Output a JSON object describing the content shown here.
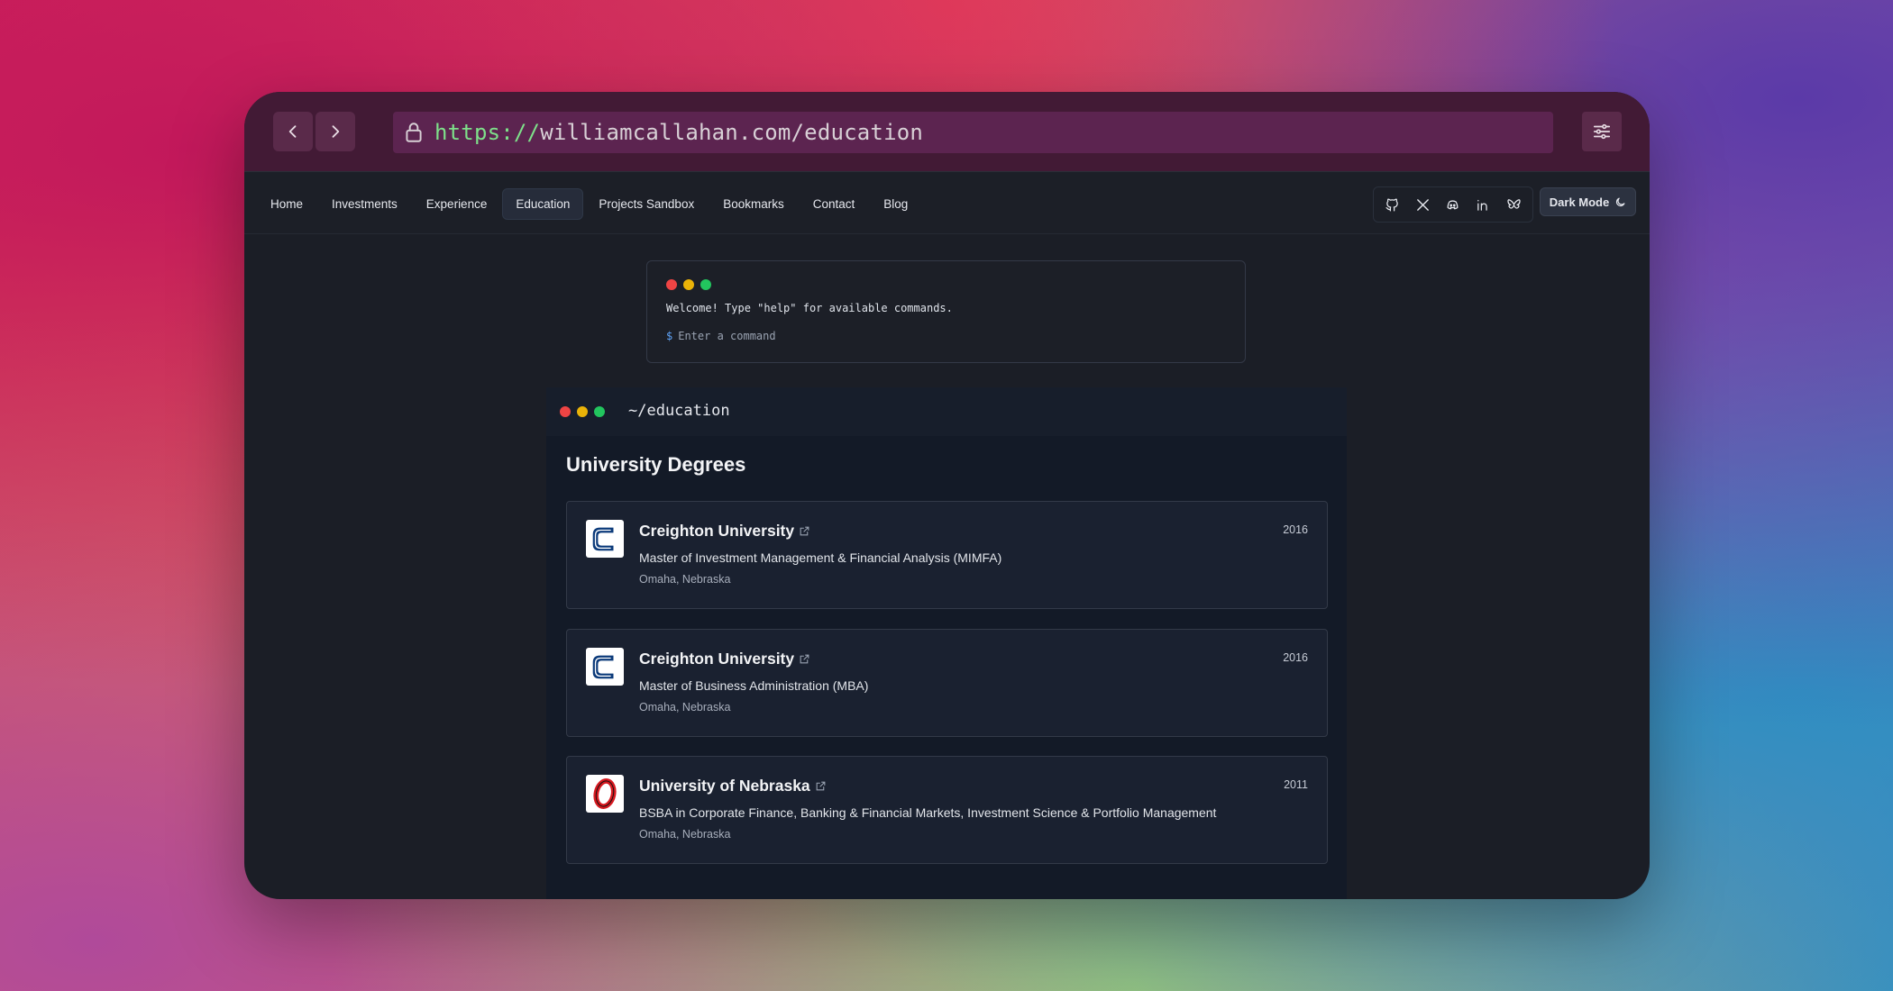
{
  "browser": {
    "url_scheme": "https://",
    "url_rest": "williamcallahan.com/education"
  },
  "nav": {
    "links": [
      "Home",
      "Investments",
      "Experience",
      "Education",
      "Projects Sandbox",
      "Bookmarks",
      "Contact",
      "Blog"
    ],
    "active": "Education",
    "dark_mode_label": "Dark Mode",
    "social_icons": [
      "github-icon",
      "x-icon",
      "discord-icon",
      "linkedin-icon",
      "bluesky-icon"
    ]
  },
  "terminal": {
    "welcome": "Welcome! Type \"help\" for available commands.",
    "prompt_symbol": "$",
    "placeholder": "Enter a command"
  },
  "education": {
    "path": "~/education",
    "title": "University Degrees",
    "degrees": [
      {
        "university": "Creighton University",
        "degree": "Master of Investment Management & Financial Analysis (MIMFA)",
        "location": "Omaha, Nebraska",
        "year": "2016",
        "logo": "creighton-logo"
      },
      {
        "university": "Creighton University",
        "degree": "Master of Business Administration (MBA)",
        "location": "Omaha, Nebraska",
        "year": "2016",
        "logo": "creighton-logo"
      },
      {
        "university": "University of Nebraska",
        "degree": "BSBA in Corporate Finance, Banking & Financial Markets, Investment Science & Portfolio Management",
        "location": "Omaha, Nebraska",
        "year": "2011",
        "logo": "unomaha-logo"
      }
    ]
  },
  "colors": {
    "accent_url": "#7ee08a",
    "topbar": "#421a35",
    "page_bg": "#1b1e26",
    "dot_red": "#ef4444",
    "dot_yellow": "#eab308",
    "dot_green": "#22c55e"
  }
}
